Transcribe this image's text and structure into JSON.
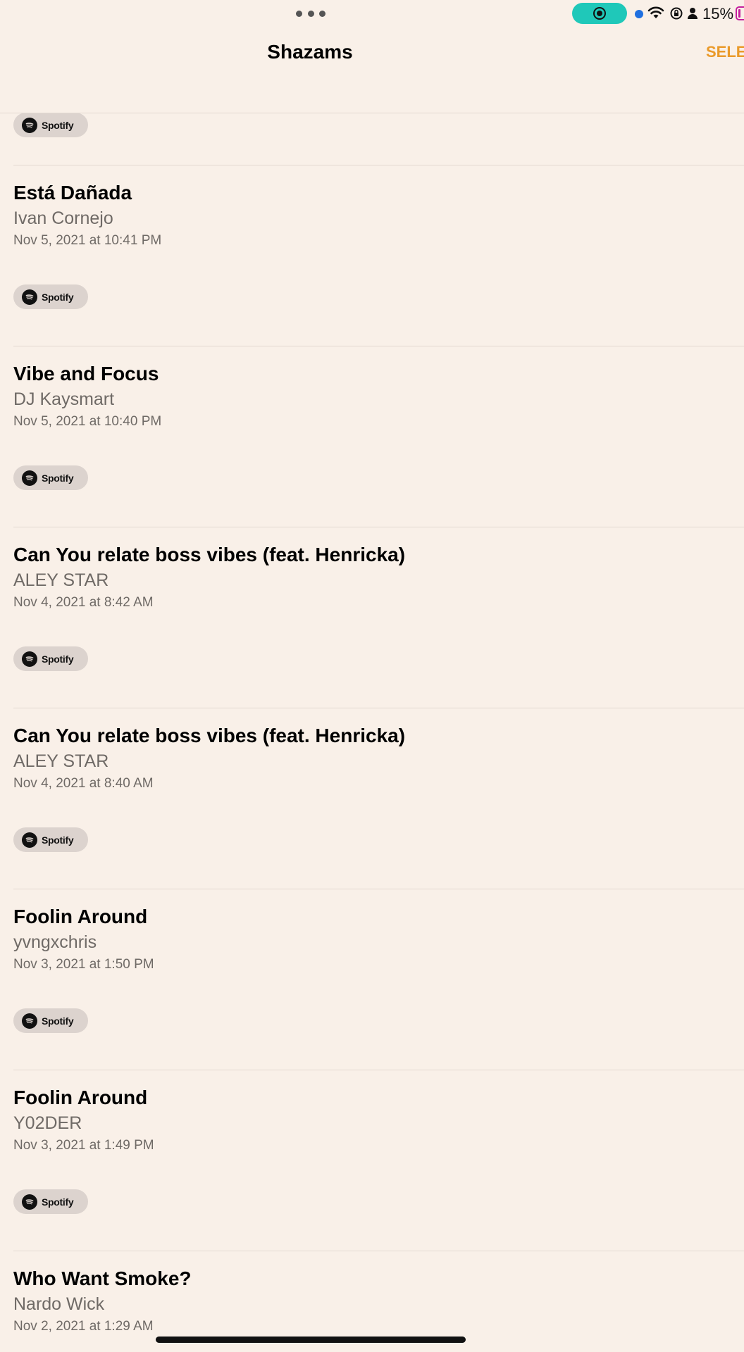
{
  "status_bar": {
    "battery_percent": "15%",
    "accent_colors": {
      "screen_recording": "#1fc8b9",
      "mic": "#1f6fe0",
      "battery": "#c41f9d"
    }
  },
  "nav": {
    "title": "Shazams",
    "select_label": "SELE"
  },
  "spotify_label": "Spotify",
  "items": [
    {
      "title": "Está Dañada",
      "artist": "Ivan Cornejo",
      "date": "Nov 5, 2021 at 10:41 PM"
    },
    {
      "title": "Vibe and Focus",
      "artist": "DJ Kaysmart",
      "date": "Nov 5, 2021 at 10:40 PM"
    },
    {
      "title": "Can You relate boss vibes (feat. Henricka)",
      "artist": "ALEY STAR",
      "date": "Nov 4, 2021 at 8:42 AM"
    },
    {
      "title": "Can You relate boss vibes (feat. Henricka)",
      "artist": "ALEY STAR",
      "date": "Nov 4, 2021 at 8:40 AM"
    },
    {
      "title": "Foolin Around",
      "artist": "yvngxchris",
      "date": "Nov 3, 2021 at 1:50 PM"
    },
    {
      "title": "Foolin Around",
      "artist": "Y02DER",
      "date": "Nov 3, 2021 at 1:49 PM"
    },
    {
      "title": "Who Want Smoke?",
      "artist": "Nardo Wick",
      "date": "Nov 2, 2021 at 1:29 AM"
    }
  ]
}
